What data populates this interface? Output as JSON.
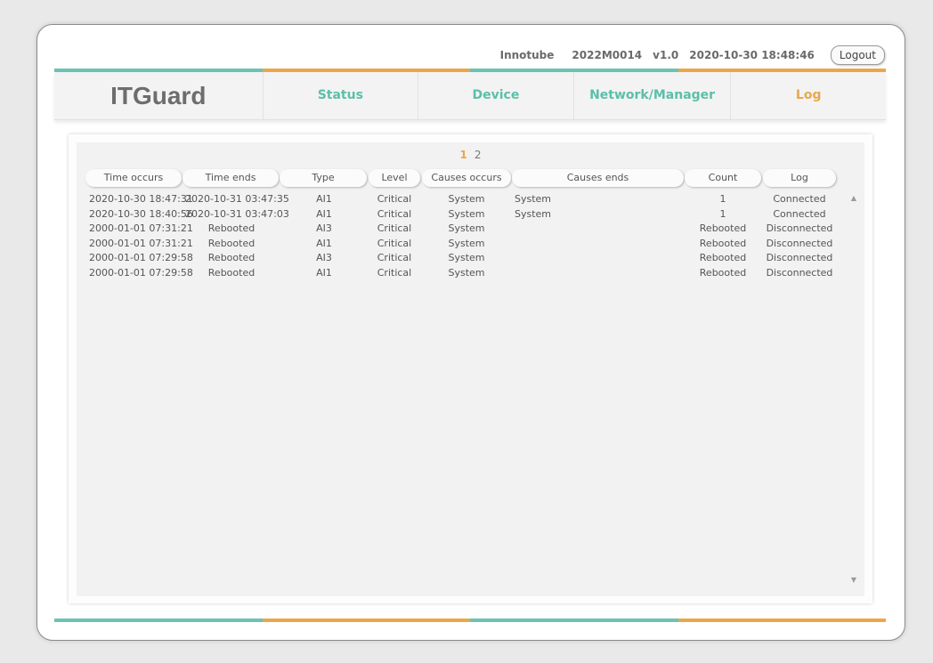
{
  "header": {
    "site": "Innotube",
    "device_id": "2022M0014",
    "version": "v1.0",
    "datetime": "2020-10-30 18:48:46",
    "logout_label": "Logout"
  },
  "nav": {
    "brand": "ITGuard",
    "tabs": [
      {
        "label": "Status"
      },
      {
        "label": "Device"
      },
      {
        "label": "Network/Manager"
      },
      {
        "label": "Log"
      }
    ],
    "active_tab": "Log"
  },
  "pagination": {
    "pages": [
      "1",
      "2"
    ],
    "current": "1"
  },
  "table": {
    "columns": [
      "Time occurs",
      "Time ends",
      "Type",
      "Level",
      "Causes occurs",
      "Causes ends",
      "Count",
      "Log"
    ],
    "rows": [
      {
        "time_occurs": "2020-10-30 18:47:31",
        "time_ends": "2020-10-31 03:47:35",
        "type": "AI1",
        "level": "Critical",
        "causes_occurs": "System",
        "causes_ends": "System",
        "count": "1",
        "log": "Connected"
      },
      {
        "time_occurs": "2020-10-30 18:40:56",
        "time_ends": "2020-10-31 03:47:03",
        "type": "AI1",
        "level": "Critical",
        "causes_occurs": "System",
        "causes_ends": "System",
        "count": "1",
        "log": "Connected"
      },
      {
        "time_occurs": "2000-01-01 07:31:21",
        "time_ends": "Rebooted",
        "type": "AI3",
        "level": "Critical",
        "causes_occurs": "System",
        "causes_ends": "",
        "count": "Rebooted",
        "log": "Disconnected"
      },
      {
        "time_occurs": "2000-01-01 07:31:21",
        "time_ends": "Rebooted",
        "type": "AI1",
        "level": "Critical",
        "causes_occurs": "System",
        "causes_ends": "",
        "count": "Rebooted",
        "log": "Disconnected"
      },
      {
        "time_occurs": "2000-01-01 07:29:58",
        "time_ends": "Rebooted",
        "type": "AI3",
        "level": "Critical",
        "causes_occurs": "System",
        "causes_ends": "",
        "count": "Rebooted",
        "log": "Disconnected"
      },
      {
        "time_occurs": "2000-01-01 07:29:58",
        "time_ends": "Rebooted",
        "type": "AI1",
        "level": "Critical",
        "causes_occurs": "System",
        "causes_ends": "",
        "count": "Rebooted",
        "log": "Disconnected"
      }
    ]
  },
  "colors": {
    "teal": "#6cc3b3",
    "orange": "#eaa74a"
  },
  "icons": {
    "scroll_up": "triangle-up-icon",
    "scroll_down": "triangle-down-icon"
  }
}
